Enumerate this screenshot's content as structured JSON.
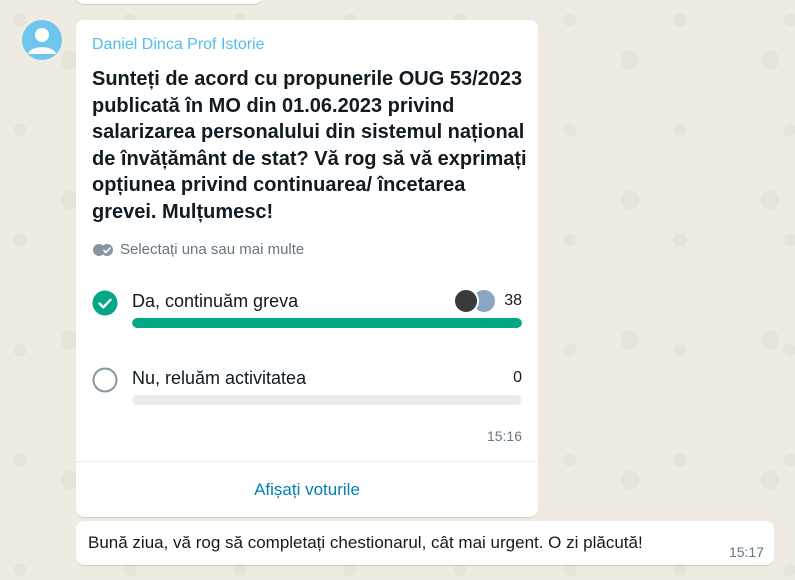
{
  "chat": {
    "poll_message": {
      "sender": "Daniel Dinca Prof Istorie",
      "question": "Sunteți de acord cu propunerile OUG 53/2023 publicată în MO din 01.06.2023 privind salarizarea personalului din sistemul național de învățământ de stat? Vă rog să vă exprimați opțiunea privind continuarea/ încetarea grevei. Mulțumesc!",
      "hint": "Selectați una sau mai multe",
      "options": [
        {
          "label": "Da, continuăm greva",
          "votes": "38",
          "selected": true,
          "fill_fraction": 1.0
        },
        {
          "label": "Nu, reluăm activitatea",
          "votes": "0",
          "selected": false,
          "fill_fraction": 0.0
        }
      ],
      "time": "15:16",
      "view_votes_label": "Afișați voturile"
    },
    "text_message": {
      "text": "Bună ziua, vă rog să completați chestionarul, cât mai urgent. O zi plăcută!",
      "time": "15:17"
    }
  },
  "colors": {
    "accent_green": "#02a884",
    "sender_name": "#53bdeb",
    "link_blue": "#027eb5",
    "wallpaper": "#efeae2"
  }
}
